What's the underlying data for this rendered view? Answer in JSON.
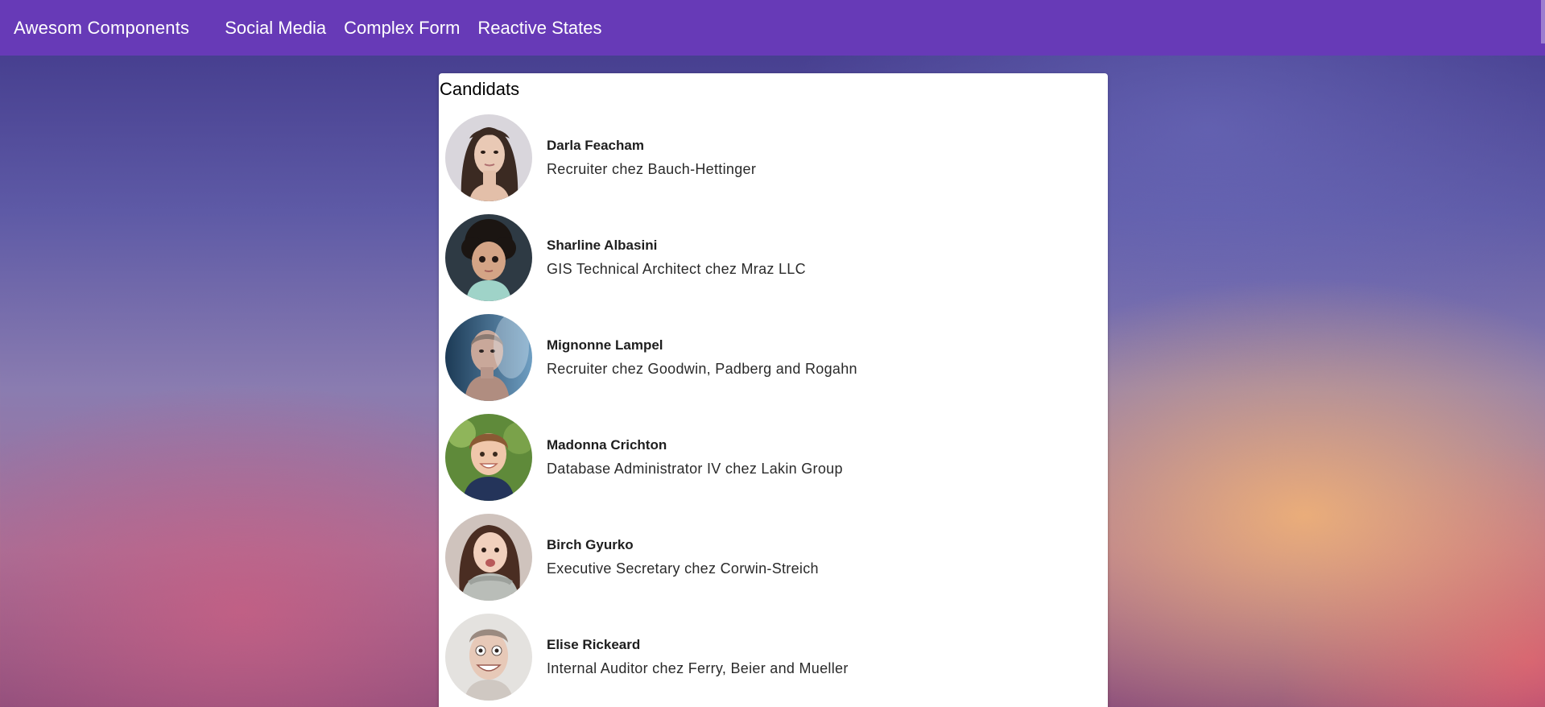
{
  "app": {
    "brand": "Awesom Components",
    "nav": [
      "Social Media",
      "Complex Form",
      "Reactive States"
    ]
  },
  "card": {
    "title": "Candidats",
    "candidates": [
      {
        "name": "Darla Feacham",
        "role": "Recruiter chez Bauch-Hettinger"
      },
      {
        "name": "Sharline Albasini",
        "role": "GIS Technical Architect chez Mraz LLC"
      },
      {
        "name": "Mignonne Lampel",
        "role": "Recruiter chez Goodwin, Padberg and Rogahn"
      },
      {
        "name": "Madonna Crichton",
        "role": "Database Administrator IV chez Lakin Group"
      },
      {
        "name": "Birch Gyurko",
        "role": "Executive Secretary chez Corwin-Streich"
      },
      {
        "name": "Elise Rickeard",
        "role": "Internal Auditor chez Ferry, Beier and Mueller"
      }
    ]
  },
  "colors": {
    "toolbar": "#673ab7",
    "card_background": "#ffffff"
  }
}
